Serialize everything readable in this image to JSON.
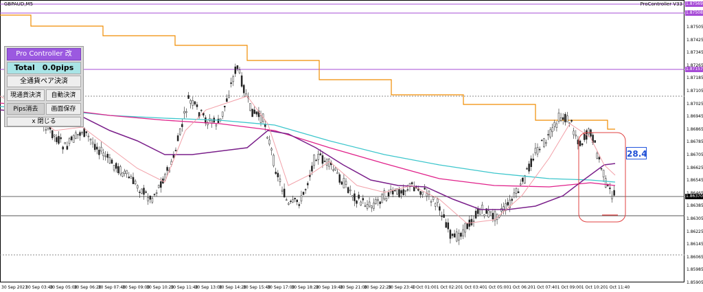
{
  "chart": {
    "symbol": "GBPAUD,M5",
    "indicator_title": "ProController V33"
  },
  "price_axis": [
    {
      "value": "1.87505"
    },
    {
      "value": "1.87425"
    },
    {
      "value": "1.87345"
    },
    {
      "value": "1.87265"
    },
    {
      "value": "1.87185"
    },
    {
      "value": "1.87105"
    },
    {
      "value": "1.87025"
    },
    {
      "value": "1.86945"
    },
    {
      "value": "1.86865"
    },
    {
      "value": "1.86785"
    },
    {
      "value": "1.86705"
    },
    {
      "value": "1.86625"
    },
    {
      "value": "1.86545"
    },
    {
      "value": "1.86465"
    },
    {
      "value": "1.86385"
    },
    {
      "value": "1.86305"
    },
    {
      "value": "1.86225"
    },
    {
      "value": "1.86145"
    },
    {
      "value": "1.86065"
    },
    {
      "value": "1.85985"
    },
    {
      "value": "1.85905"
    }
  ],
  "price_tags": [
    {
      "value": "1.87569",
      "color": "#a64bd6"
    },
    {
      "value": "1.87508",
      "color": "#a64bd6"
    },
    {
      "value": "1.87157",
      "color": "#a64bd6"
    },
    {
      "value": "1.86370",
      "color": "#000000"
    }
  ],
  "time_axis": [
    "30 Sep 2021",
    "30 Sep 03:40",
    "30 Sep 05:00",
    "30 Sep 06:20",
    "30 Sep 07:40",
    "30 Sep 09:00",
    "30 Sep 10:20",
    "30 Sep 11:40",
    "30 Sep 13:00",
    "30 Sep 14:20",
    "30 Sep 15:40",
    "30 Sep 17:00",
    "30 Sep 18:20",
    "30 Sep 19:40",
    "30 Sep 21:00",
    "30 Sep 22:20",
    "30 Sep 23:40",
    "1 Oct 01:00",
    "1 Oct 02:20",
    "1 Oct 03:40",
    "1 Oct 05:00",
    "1 Oct 06:20",
    "1 Oct 07:40",
    "1 Oct 09:00",
    "1 Oct 10:20",
    "1 Oct 11:40"
  ],
  "panel": {
    "title": "Pro Controller 改",
    "total": "Total　0.0pips",
    "close_all_pairs": "全通貨ペア決済",
    "close_current": "現通貨決済",
    "auto_close": "自動決済",
    "clear_pips": "Pips消去",
    "save_screen": "画面保存",
    "close": "x 閉じる"
  },
  "pips_display": "28.4",
  "colors": {
    "bull": "#ffffff",
    "bear": "#222222",
    "ma_purple": "#7a1f8a",
    "ma_pink": "#e0218a",
    "ma_cyan": "#3cc6cc",
    "ma_thin": "#f2a0a8",
    "step_orange": "#f08c00",
    "level_purple": "#a64bd6",
    "box_red": "#e04040"
  }
}
